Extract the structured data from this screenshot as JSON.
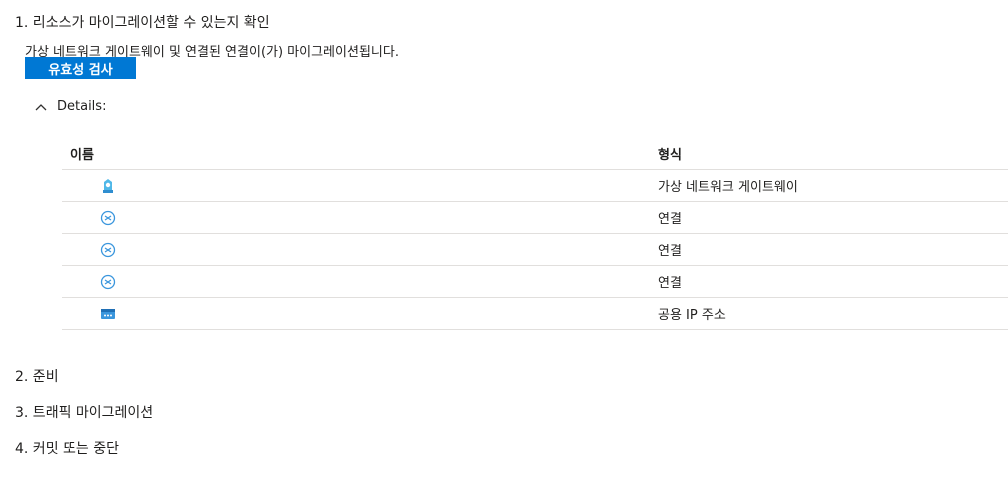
{
  "steps": [
    {
      "label": "1. 리소스가 마이그레이션할 수 있는지 확인"
    },
    {
      "label": "2. 준비"
    },
    {
      "label": "3. 트래픽 마이그레이션"
    },
    {
      "label": "4. 커밋 또는 중단"
    }
  ],
  "validation": {
    "description": "가상 네트워크 게이트웨이 및 연결된 연결이(가) 마이그레이션됩니다.",
    "button_label": "유효성 검사",
    "accent_color": "#0078d4"
  },
  "details": {
    "toggle_label": "Details:",
    "toggle_icon": "chevron-up-icon",
    "columns": {
      "name": "이름",
      "type": "형식"
    },
    "rows": [
      {
        "icon": "virtual-network-gateway-icon",
        "name": "",
        "type": "가상 네트워크 게이트웨이"
      },
      {
        "icon": "connection-icon",
        "name": "",
        "type": "연결"
      },
      {
        "icon": "connection-icon",
        "name": "",
        "type": "연결"
      },
      {
        "icon": "connection-icon",
        "name": "",
        "type": "연결"
      },
      {
        "icon": "public-ip-address-icon",
        "name": "",
        "type": "공용 IP 주소"
      }
    ]
  }
}
